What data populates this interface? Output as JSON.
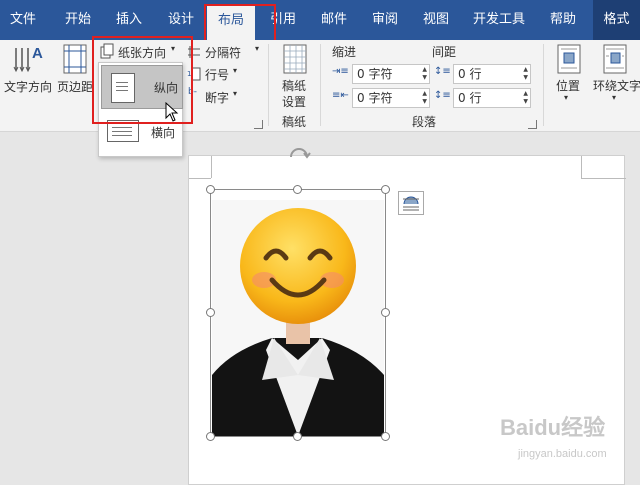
{
  "tabs": [
    "文件",
    "开始",
    "插入",
    "设计",
    "布局",
    "引用",
    "邮件",
    "审阅",
    "视图",
    "开发工具",
    "帮助",
    "格式"
  ],
  "ribbon": {
    "text_direction": "文字方向",
    "margins": "页边距",
    "orientation": "纸张方向",
    "breaks": "分隔符",
    "line_numbers": "行号",
    "hyphenation": "断字",
    "manuscript_line1": "稿纸",
    "manuscript_line2": "设置",
    "manuscript_group": "稿纸",
    "indent_label": "缩进",
    "spacing_label": "间距",
    "indent_left": "0 字符",
    "indent_right": "0 字符",
    "spacing_before": "0 行",
    "spacing_after": "0 行",
    "paragraph_group": "段落",
    "position": "位置",
    "wrap_text": "环绕文字"
  },
  "dropdown": {
    "portrait": "纵向",
    "landscape": "横向"
  },
  "watermark": {
    "brand": "Baidu经验",
    "url": "jingyan.baidu.com"
  },
  "colors": {
    "tab_blue": "#2b579a",
    "highlight_red": "#e0201f",
    "ribbon_bg": "#f3f3f3"
  }
}
